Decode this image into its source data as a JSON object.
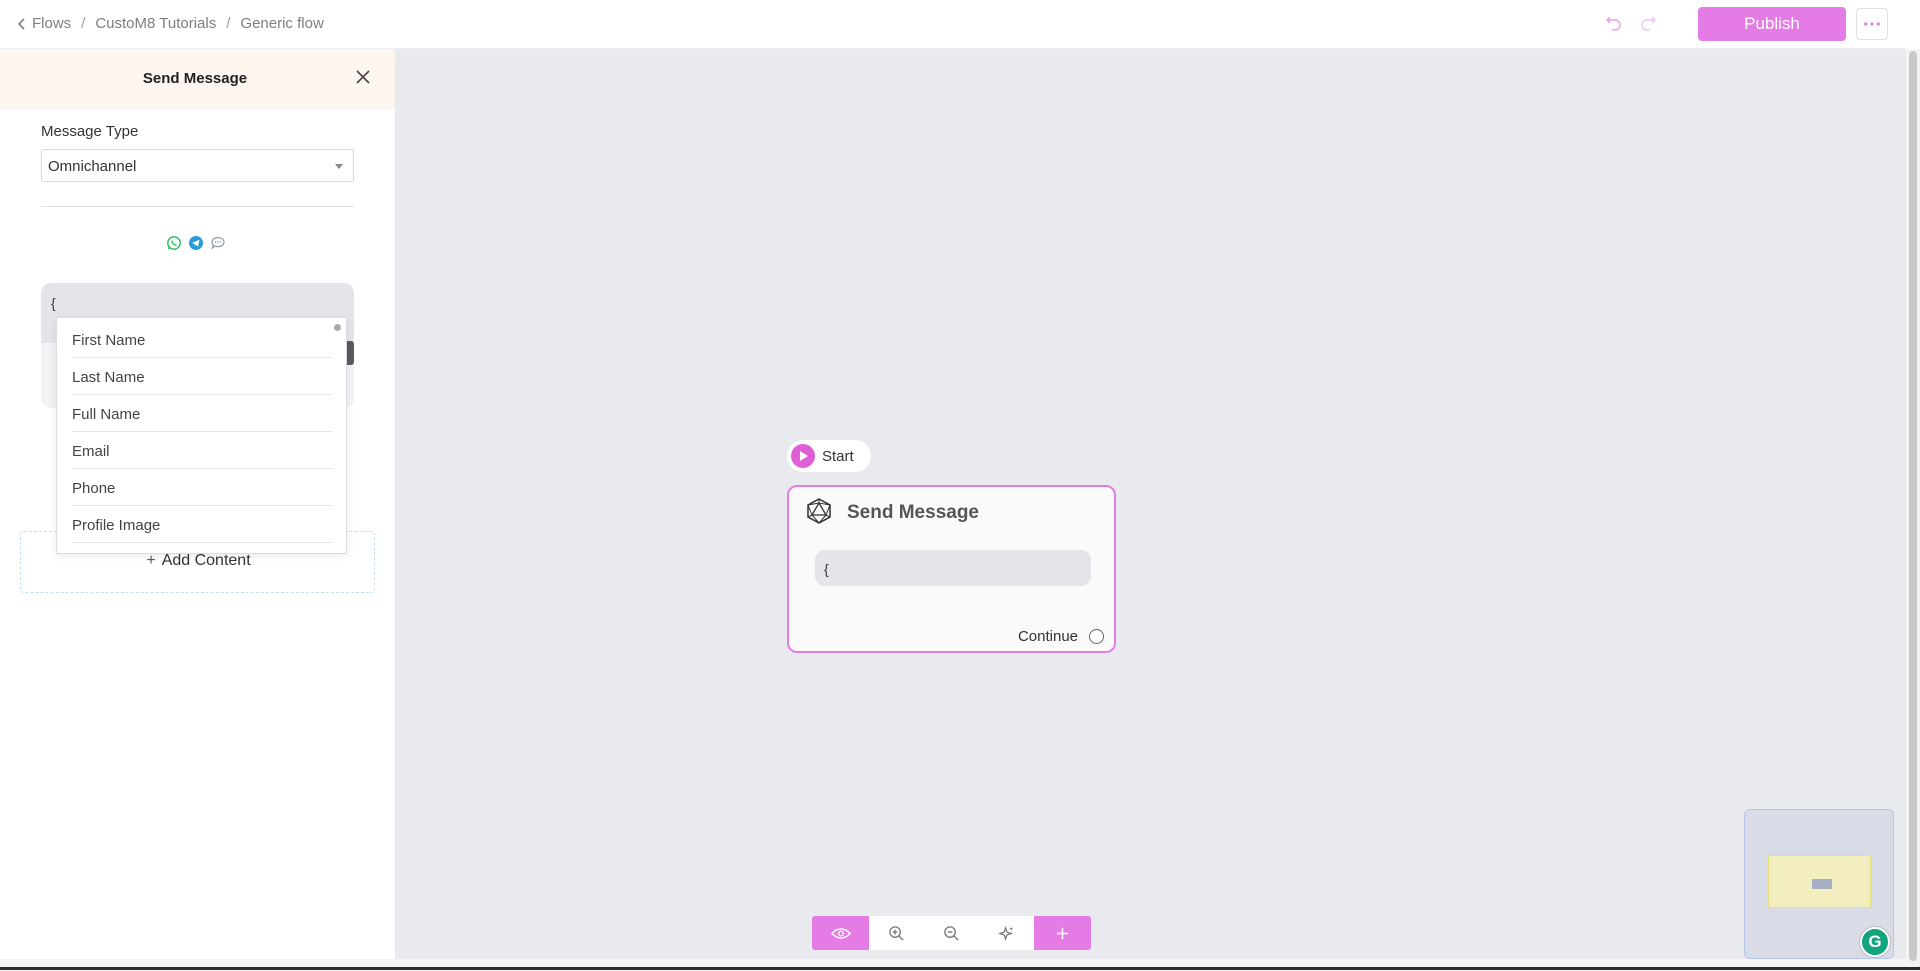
{
  "breadcrumb": {
    "items": [
      "Flows",
      "CustoM8 Tutorials",
      "Generic flow"
    ],
    "separator": "/"
  },
  "header": {
    "publish_label": "Publish"
  },
  "panel": {
    "title": "Send Message",
    "message_type_label": "Message Type",
    "message_type_value": "Omnichannel",
    "message_text": "{",
    "channels": [
      "whatsapp-icon",
      "telegram-icon",
      "chat-icon"
    ],
    "variables": [
      "First Name",
      "Last Name",
      "Full Name",
      "Email",
      "Phone",
      "Profile Image"
    ],
    "add_content_label": "Add Content"
  },
  "canvas": {
    "start_label": "Start",
    "node": {
      "title": "Send Message",
      "preview_text": "{",
      "continue_label": "Continue"
    }
  },
  "colors": {
    "accent": "#e57ce6",
    "start": "#e15fd6",
    "canvas_bg": "#e9eaee",
    "panel_header_bg": "#fdf6ef"
  },
  "grammarly_label": "G"
}
